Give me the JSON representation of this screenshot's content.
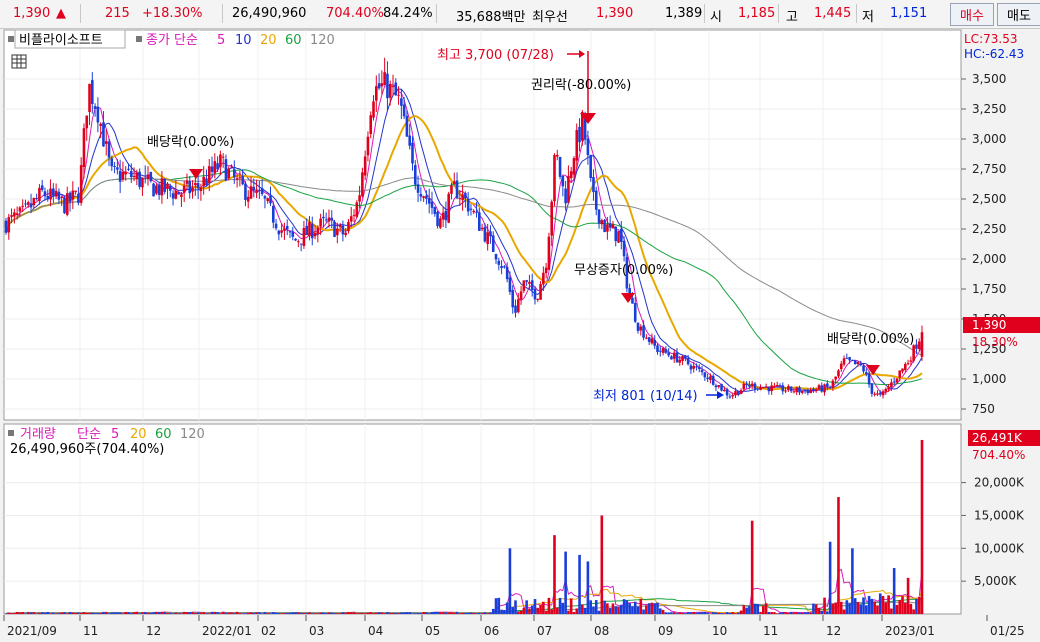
{
  "topbar": {
    "price": "1,390",
    "price_arrow": "▲",
    "change": "215",
    "change_pct": "+18.30%",
    "volume": "26,490,960",
    "volume_ratio": "704.40%",
    "turnover": "84.24%",
    "amount": "35,688백만",
    "best_label": "최우선",
    "ask": "1,390",
    "bid": "1,389",
    "open_label": "시",
    "open": "1,185",
    "high_label": "고",
    "high": "1,445",
    "low_label": "저",
    "low": "1,151",
    "buy_button": "매수",
    "sell_button": "매도"
  },
  "price_panel": {
    "stock_name": "비플라이소프트",
    "ma_prefix": "종가 단순",
    "ma_labels": [
      "5",
      "10",
      "20",
      "60",
      "120"
    ],
    "lc": "LC:73.53",
    "hc": "HC:-62.43",
    "current_tag": "1,390",
    "current_pct": "18.30%",
    "annotations": [
      {
        "text": "최고 3,700 (07/28)",
        "color": "#e0001e"
      },
      {
        "text": "권리락(-80.00%)",
        "color": "#000000"
      },
      {
        "text": "배당락(0.00%)",
        "color": "#000000"
      },
      {
        "text": "무상증자(0.00%)",
        "color": "#000000"
      },
      {
        "text": "배당락(0.00%)",
        "color": "#000000"
      },
      {
        "text": "최저 801 (10/14)",
        "color": "#0026d8"
      }
    ]
  },
  "volume_panel": {
    "title": "거래량",
    "ma_prefix": "단순",
    "ma_labels": [
      "5",
      "20",
      "60",
      "120"
    ],
    "value_line": "26,490,960주(704.40%)",
    "current_tag": "26,491K",
    "current_pct": "704.40%"
  },
  "colors": {
    "up": "#e0001e",
    "down": "#1a3fd8",
    "ma5": "#d81bb8",
    "ma10": "#2233cc",
    "ma20": "#e8a800",
    "ma60": "#19a341",
    "ma120": "#8a8a8a"
  },
  "chart_data": [
    {
      "type": "candlestick",
      "title": "비플라이소프트",
      "ylim": [
        650,
        3750
      ],
      "y_ticks": [
        "3,500",
        "3,250",
        "3,000",
        "2,750",
        "2,500",
        "2,250",
        "2,000",
        "1,750",
        "1,500",
        "1,250",
        "1,000",
        "750"
      ],
      "x_tick_labels": [
        "2021/09",
        "11",
        "12",
        "2022/01",
        "02",
        "03",
        "04",
        "05",
        "06",
        "07",
        "08",
        "09",
        "10",
        "11",
        "12",
        "2023/01",
        "01/25"
      ],
      "close_keypoints": [
        {
          "x": 0,
          "y": 2300
        },
        {
          "x": 0.02,
          "y": 2380
        },
        {
          "x": 0.04,
          "y": 2550
        },
        {
          "x": 0.065,
          "y": 2450
        },
        {
          "x": 0.08,
          "y": 2550
        },
        {
          "x": 0.09,
          "y": 3450
        },
        {
          "x": 0.1,
          "y": 3250
        },
        {
          "x": 0.115,
          "y": 2700
        },
        {
          "x": 0.135,
          "y": 2700
        },
        {
          "x": 0.16,
          "y": 2600
        },
        {
          "x": 0.19,
          "y": 2550
        },
        {
          "x": 0.21,
          "y": 2600
        },
        {
          "x": 0.235,
          "y": 2800
        },
        {
          "x": 0.255,
          "y": 2600
        },
        {
          "x": 0.28,
          "y": 2500
        },
        {
          "x": 0.3,
          "y": 2250
        },
        {
          "x": 0.315,
          "y": 2150
        },
        {
          "x": 0.335,
          "y": 2250
        },
        {
          "x": 0.35,
          "y": 2300
        },
        {
          "x": 0.37,
          "y": 2200
        },
        {
          "x": 0.385,
          "y": 2500
        },
        {
          "x": 0.4,
          "y": 3400
        },
        {
          "x": 0.415,
          "y": 3450
        },
        {
          "x": 0.43,
          "y": 3300
        },
        {
          "x": 0.445,
          "y": 2700
        },
        {
          "x": 0.46,
          "y": 2500
        },
        {
          "x": 0.475,
          "y": 2300
        },
        {
          "x": 0.49,
          "y": 2600
        },
        {
          "x": 0.505,
          "y": 2450
        },
        {
          "x": 0.52,
          "y": 2250
        },
        {
          "x": 0.535,
          "y": 2050
        },
        {
          "x": 0.545,
          "y": 1900
        },
        {
          "x": 0.555,
          "y": 1550
        },
        {
          "x": 0.565,
          "y": 1800
        },
        {
          "x": 0.58,
          "y": 1700
        },
        {
          "x": 0.59,
          "y": 2000
        },
        {
          "x": 0.6,
          "y": 2900
        },
        {
          "x": 0.61,
          "y": 2500
        },
        {
          "x": 0.62,
          "y": 2900
        },
        {
          "x": 0.63,
          "y": 3150
        },
        {
          "x": 0.64,
          "y": 2500
        },
        {
          "x": 0.655,
          "y": 2250
        },
        {
          "x": 0.67,
          "y": 2200
        },
        {
          "x": 0.68,
          "y": 1700
        },
        {
          "x": 0.69,
          "y": 1450
        },
        {
          "x": 0.71,
          "y": 1250
        },
        {
          "x": 0.74,
          "y": 1150
        },
        {
          "x": 0.77,
          "y": 1000
        },
        {
          "x": 0.79,
          "y": 860
        },
        {
          "x": 0.81,
          "y": 950
        },
        {
          "x": 0.84,
          "y": 920
        },
        {
          "x": 0.87,
          "y": 900
        },
        {
          "x": 0.9,
          "y": 930
        },
        {
          "x": 0.915,
          "y": 1150
        },
        {
          "x": 0.935,
          "y": 1100
        },
        {
          "x": 0.945,
          "y": 900
        },
        {
          "x": 0.955,
          "y": 850
        },
        {
          "x": 0.97,
          "y": 1000
        },
        {
          "x": 0.985,
          "y": 1150
        },
        {
          "x": 1,
          "y": 1390
        }
      ],
      "series": [
        {
          "name": "5",
          "color": "#d81bb8"
        },
        {
          "name": "10",
          "color": "#2233cc"
        },
        {
          "name": "20",
          "color": "#e8a800"
        },
        {
          "name": "60",
          "color": "#19a341"
        },
        {
          "name": "120",
          "color": "#8a8a8a"
        }
      ]
    },
    {
      "type": "bar",
      "title": "거래량",
      "y_ticks": [
        "20,000K",
        "15,000K",
        "10,000K",
        "5,000K"
      ],
      "ylim": [
        0,
        28000
      ],
      "spikes_k": [
        {
          "x": 0.55,
          "v": 10000
        },
        {
          "x": 0.6,
          "v": 12000
        },
        {
          "x": 0.61,
          "v": 9500
        },
        {
          "x": 0.625,
          "v": 9000
        },
        {
          "x": 0.635,
          "v": 8000
        },
        {
          "x": 0.65,
          "v": 15000
        },
        {
          "x": 0.815,
          "v": 14200
        },
        {
          "x": 0.9,
          "v": 11000
        },
        {
          "x": 0.91,
          "v": 17800
        },
        {
          "x": 0.925,
          "v": 10000
        },
        {
          "x": 0.97,
          "v": 7000
        },
        {
          "x": 0.985,
          "v": 5500
        },
        {
          "x": 1,
          "v": 26491
        }
      ]
    }
  ]
}
